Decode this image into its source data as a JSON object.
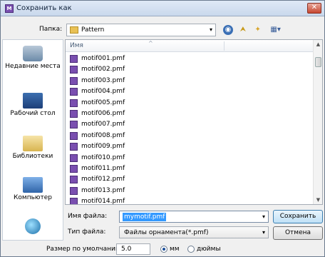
{
  "window": {
    "title": "Сохранить как",
    "close_glyph": "✕",
    "app_icon_glyph": "M"
  },
  "folder": {
    "label": "Папка:",
    "current": "Pattern",
    "dropdown_glyph": "▾",
    "nav": {
      "back_glyph": "◉",
      "up_glyph": "⮝",
      "new_folder_glyph": "✦",
      "view_glyph": "▦▾"
    }
  },
  "places": [
    {
      "label": "Недавние места",
      "icon": "recent-places-icon"
    },
    {
      "label": "Рабочий стол",
      "icon": "desktop-icon"
    },
    {
      "label": "Библиотеки",
      "icon": "libraries-icon"
    },
    {
      "label": "Компьютер",
      "icon": "computer-icon"
    },
    {
      "label": "",
      "icon": "network-icon"
    }
  ],
  "filelist": {
    "column_header": "Имя",
    "sort_glyph": "^",
    "files": [
      "motif001.pmf",
      "motif002.pmf",
      "motif003.pmf",
      "motif004.pmf",
      "motif005.pmf",
      "motif006.pmf",
      "motif007.pmf",
      "motif008.pmf",
      "motif009.pmf",
      "motif010.pmf",
      "motif011.pmf",
      "motif012.pmf",
      "motif013.pmf",
      "motif014.pmf"
    ],
    "scroll_up_glyph": "▲",
    "scroll_down_glyph": "▼"
  },
  "form": {
    "filename_label": "Имя файла:",
    "filename_value": "mymotif.pmf",
    "filetype_label": "Тип файла:",
    "filetype_value": "Файлы орнамента(*.pmf)",
    "dropdown_glyph": "▾",
    "save_label": "Сохранить",
    "cancel_label": "Отмена"
  },
  "bottom": {
    "size_label": "Размер по умолчанию",
    "size_value": "5.0",
    "unit_mm": "мм",
    "unit_inch": "дюймы",
    "selected_unit": "мм"
  }
}
